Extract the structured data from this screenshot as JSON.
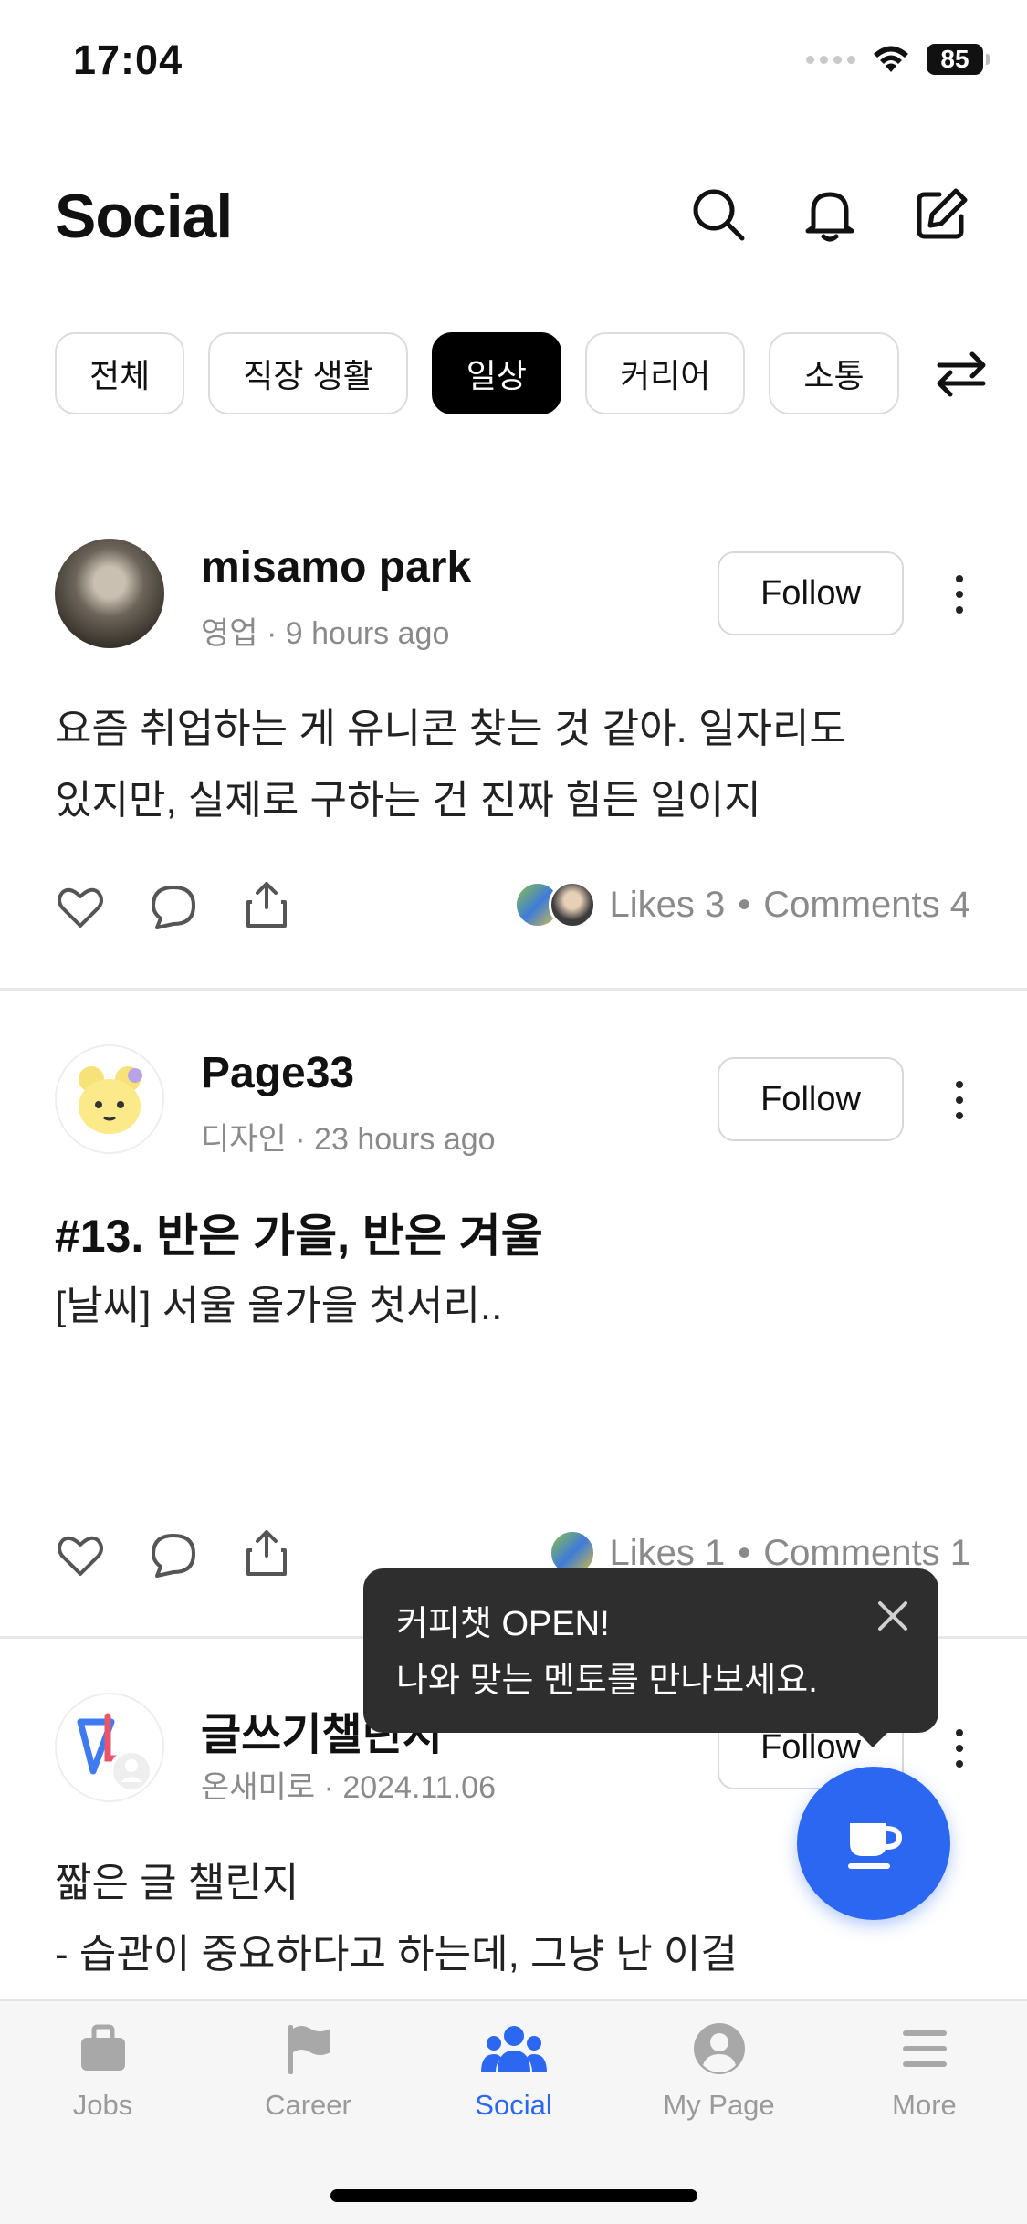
{
  "status": {
    "time": "17:04",
    "battery": "85"
  },
  "header": {
    "title": "Social"
  },
  "chips": [
    "전체",
    "직장 생활",
    "일상",
    "커리어",
    "소통"
  ],
  "active_chip": "일상",
  "posts": [
    {
      "name": "misamo park",
      "meta": "영업 · 9 hours ago",
      "follow": "Follow",
      "lines": [
        "요즘 취업하는 게 유니콘 찾는 것 같아. 일자리도",
        "있지만, 실제로 구하는 건 진짜 힘든 일이지"
      ],
      "likes": "Likes 3",
      "comments": "Comments 4"
    },
    {
      "name": "Page33",
      "meta": "디자인 · 23 hours ago",
      "follow": "Follow",
      "title": "#13. 반은 가을, 반은 겨울",
      "lines": [
        "[날씨] 서울 올가을 첫서리.."
      ],
      "likes": "Likes 1",
      "comments": "Comments 1"
    },
    {
      "name": "글쓰기챌린지",
      "meta": "온새미로 · 2024.11.06",
      "follow": "Follow",
      "lines": [
        "짧은 글 챌린지",
        "- 습관이 중요하다고 하는데, 그냥 난 이걸"
      ]
    }
  ],
  "tooltip": {
    "line1": "커피챗 OPEN!",
    "line2": "나와 맞는 멘토를 만나보세요."
  },
  "nav": [
    {
      "label": "Jobs",
      "icon": "briefcase-icon"
    },
    {
      "label": "Career",
      "icon": "flag-icon"
    },
    {
      "label": "Social",
      "icon": "people-icon"
    },
    {
      "label": "My Page",
      "icon": "person-icon"
    },
    {
      "label": "More",
      "icon": "menu-icon"
    }
  ],
  "colors": {
    "accent": "#2c67f2",
    "chip_active": "#000000"
  }
}
